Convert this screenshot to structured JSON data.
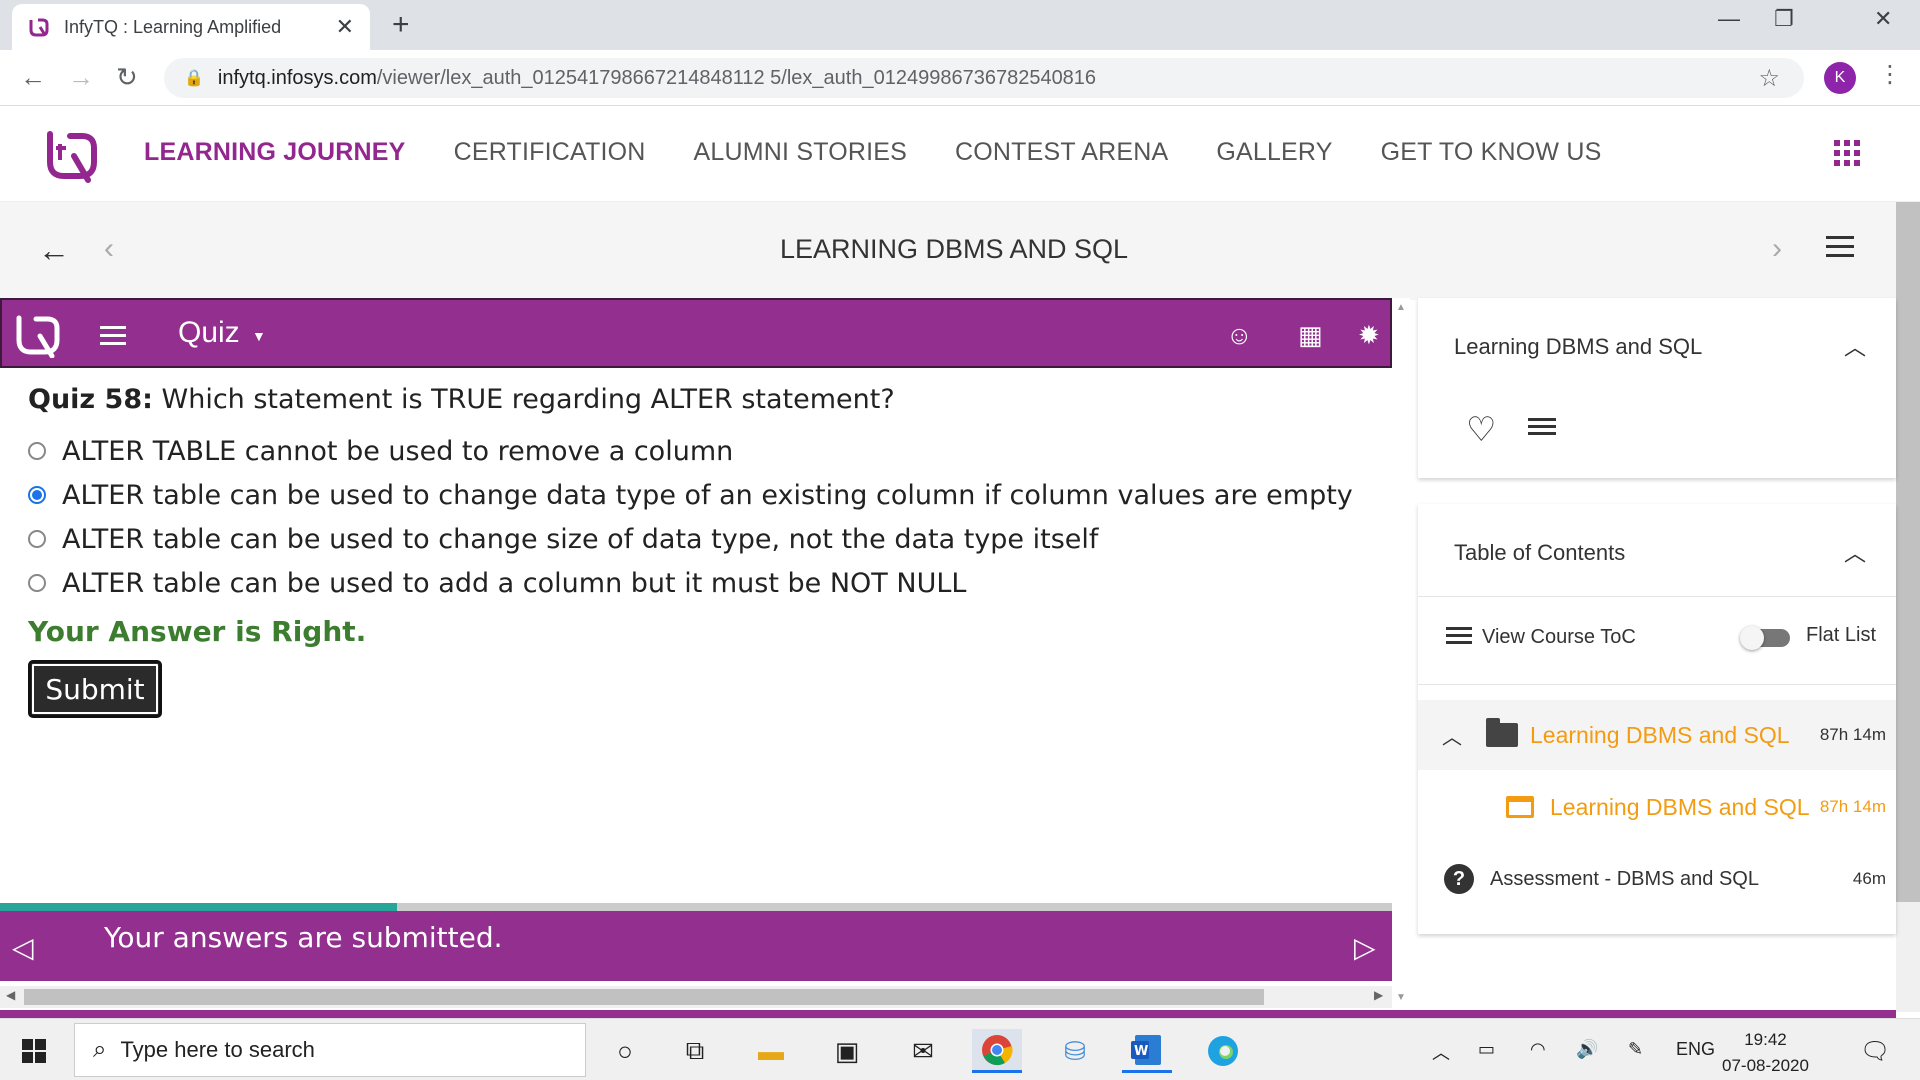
{
  "browser": {
    "tab_title": "InfyTQ : Learning Amplified",
    "url_host": "infytq.infosys.com",
    "url_path": "/viewer/lex_auth_012541798667214848112 5/lex_auth_01249986736782540816",
    "profile_initial": "K"
  },
  "site_nav": {
    "items": [
      "LEARNING JOURNEY",
      "CERTIFICATION",
      "ALUMNI STORIES",
      "CONTEST ARENA",
      "GALLERY",
      "GET TO KNOW US"
    ],
    "active_color": "#93278f"
  },
  "course": {
    "title": "LEARNING DBMS AND SQL"
  },
  "quiz": {
    "header_title": "Quiz",
    "question_label": "Quiz 58:",
    "question_text": " Which statement is TRUE regarding ALTER statement?",
    "options": [
      "ALTER TABLE cannot be used to remove a column",
      "ALTER table can be used to change data type of an existing column if column values are empty",
      "ALTER table can be used to change size of data type, not the data type itself",
      "ALTER table can be used to add a column but it must be NOT NULL"
    ],
    "selected_option": 1,
    "feedback": "Your Answer is Right.",
    "submit_label": "Submit",
    "footer_message": "Your answers are submitted.",
    "progress_fraction": 0.285,
    "brand_color": "#93308f"
  },
  "sidebar": {
    "card_title": "Learning DBMS and SQL",
    "toc_title": "Table of Contents",
    "view_toc_label": "View Course ToC",
    "flat_list_label": "Flat List",
    "toc_items": [
      {
        "title": "Learning DBMS and SQL",
        "duration": "87h 14m"
      },
      {
        "title": "Learning DBMS and SQL",
        "duration": "87h 14m"
      },
      {
        "title": "Assessment - DBMS and SQL",
        "duration": "46m"
      }
    ]
  },
  "taskbar": {
    "search_placeholder": "Type here to search",
    "language": "ENG",
    "time": "19:42",
    "date": "07-08-2020"
  }
}
